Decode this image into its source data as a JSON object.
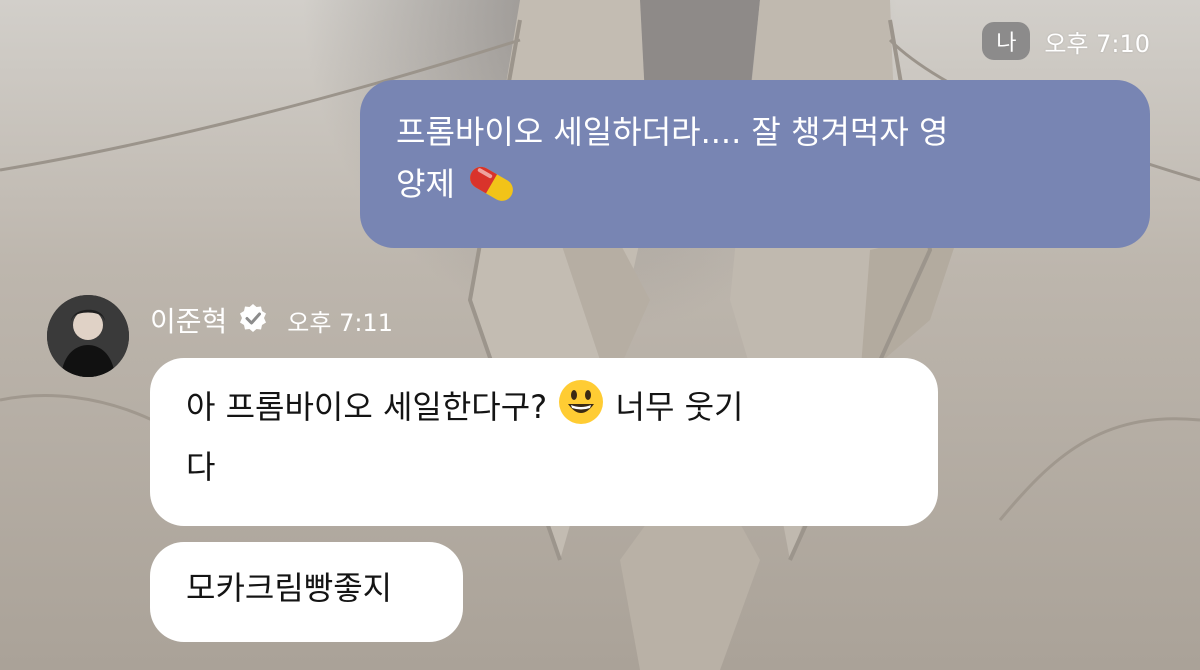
{
  "messages": {
    "me": {
      "badge": "나",
      "time": "오후 7:10",
      "text_line1": "프롬바이오 세일하더라....  잘 챙겨먹자 영",
      "text_line2": "양제",
      "emoji": "pill-icon"
    },
    "other": {
      "name": "이준혁",
      "time": "오후 7:11",
      "bubble1_part1": "아 프롬바이오 세일한다구?",
      "bubble1_part2": "너무 웃기",
      "bubble1_line2": "다",
      "bubble1_emoji": "smiley-icon",
      "bubble2": "모카크림빵좋지"
    }
  },
  "colors": {
    "my_bubble": "#7885b3",
    "other_bubble": "#ffffff"
  }
}
